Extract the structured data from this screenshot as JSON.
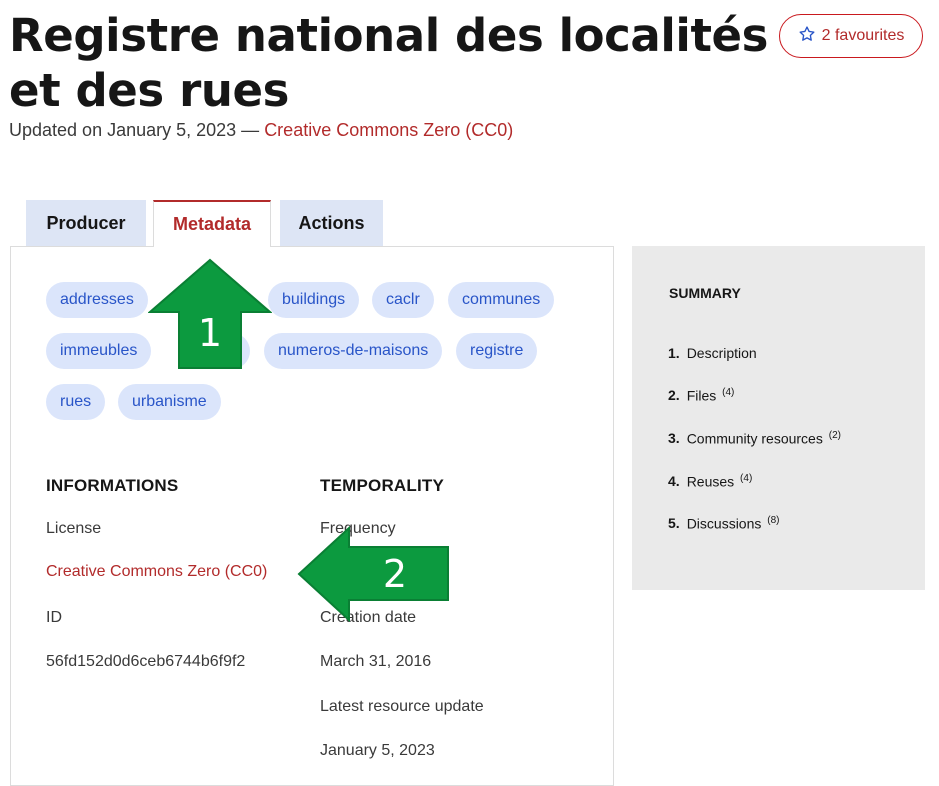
{
  "header": {
    "title": "Registre national des localités et des rues",
    "updated_text": "Updated on January 5, 2023 — ",
    "license_link": "Creative Commons Zero (CC0)",
    "favourite_label": "2 favourites",
    "favourite_icon": "star-outline-icon"
  },
  "tabs": [
    {
      "label": "Producer"
    },
    {
      "label": "Metadata"
    },
    {
      "label": "Actions"
    }
  ],
  "active_tab": "Metadata",
  "tags": [
    "addresses",
    "buildings",
    "caclr",
    "communes",
    "immeubles",
    "numeros-de-maisons",
    "registre",
    "rues",
    "urbanisme"
  ],
  "informations": {
    "heading": "INFORMATIONS",
    "license_label": "License",
    "license_value": "Creative Commons Zero (CC0)",
    "id_label": "ID",
    "id_value": "56fd152d0d6ceb6744b6f9f2"
  },
  "temporality": {
    "heading": "TEMPORALITY",
    "frequency_label": "Frequency",
    "creation_label": "Creation date",
    "creation_value": "March 31, 2016",
    "latest_label": "Latest resource update",
    "latest_value": "January 5, 2023"
  },
  "summary": {
    "title": "SUMMARY",
    "items": [
      {
        "num": "1.",
        "label": "Description",
        "count": ""
      },
      {
        "num": "2.",
        "label": "Files",
        "count": "(4)"
      },
      {
        "num": "3.",
        "label": "Community resources",
        "count": "(2)"
      },
      {
        "num": "4.",
        "label": "Reuses",
        "count": "(4)"
      },
      {
        "num": "5.",
        "label": "Discussions",
        "count": "(8)"
      }
    ]
  },
  "annotations": {
    "arrow1_label": "1",
    "arrow2_label": "2",
    "arrow_color": "#0c9a3f"
  },
  "colors": {
    "accent_red": "#b22b2b",
    "tag_bg": "#dbe5fb",
    "tag_text": "#2955c8",
    "tab_bg": "#dde5f5",
    "summary_bg": "#eaeaea"
  }
}
